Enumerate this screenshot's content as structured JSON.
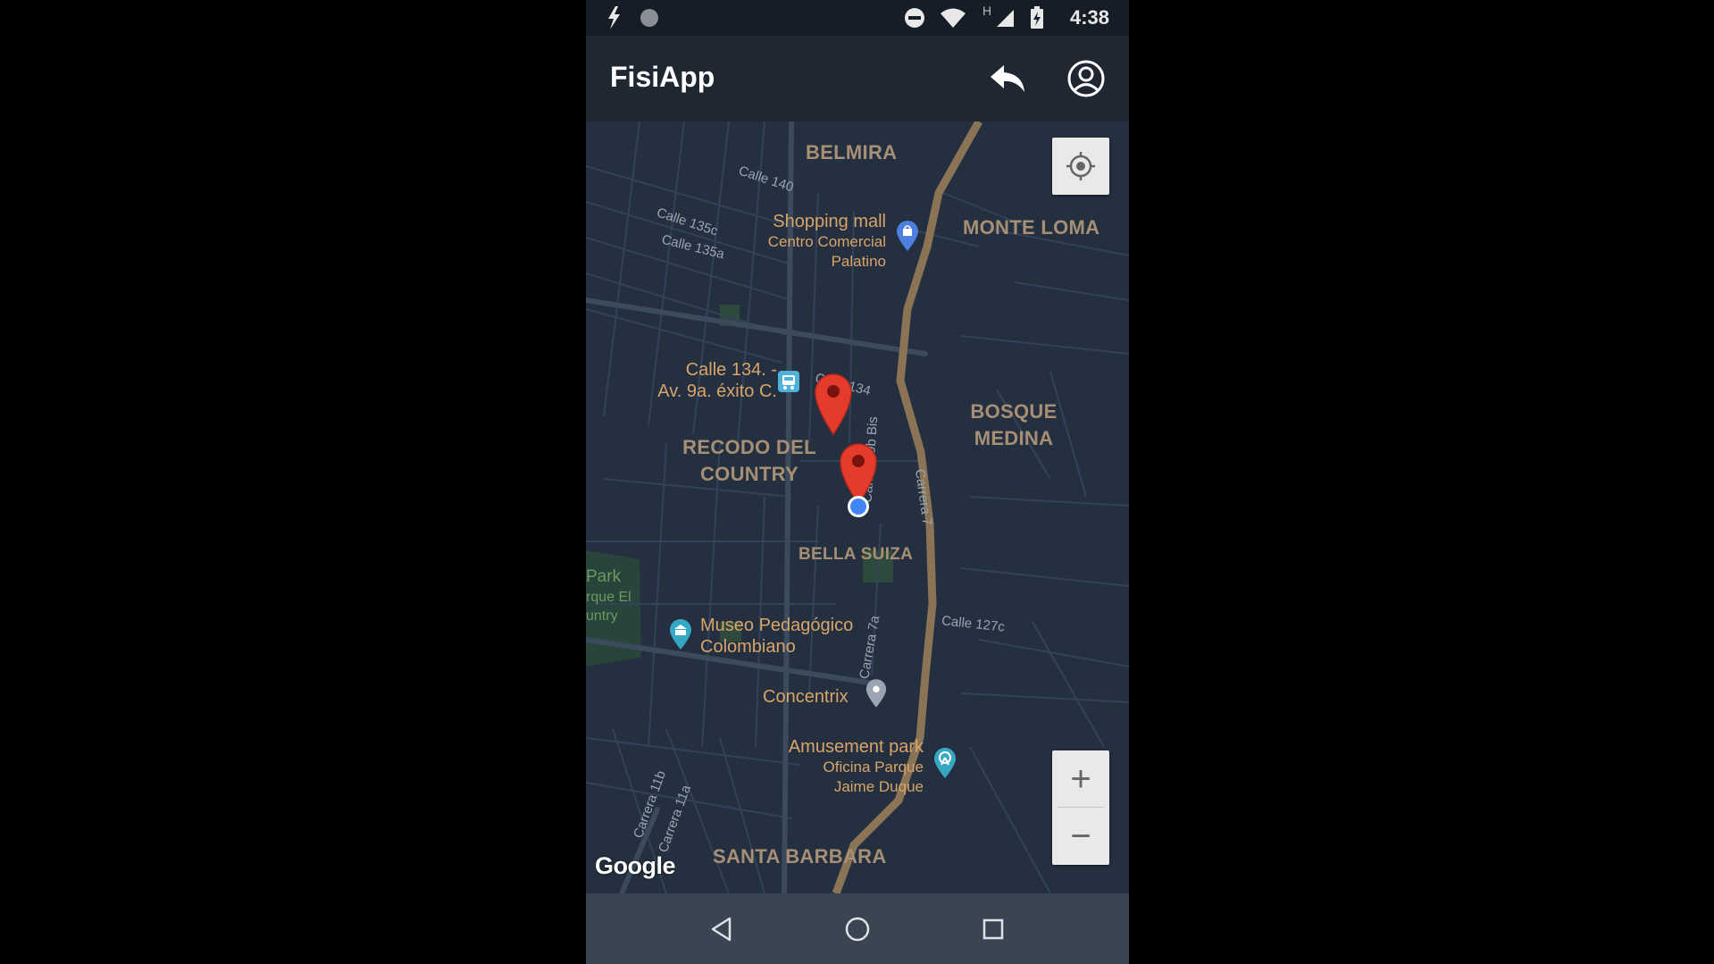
{
  "status_bar": {
    "time": "4:38",
    "network_type": "H",
    "icons": [
      "bolt-icon",
      "dot-icon",
      "do-not-disturb-icon",
      "wifi-icon",
      "signal-icon",
      "battery-charging-icon"
    ]
  },
  "app_bar": {
    "title": "FisiApp",
    "actions": [
      "reply-icon",
      "account-circle-icon"
    ]
  },
  "map": {
    "areas": {
      "belmira": "BELMIRA",
      "monte_loma": "MONTE LOMA",
      "bosque_medina": [
        "BOSQUE",
        "MEDINA"
      ],
      "recodo_del_country": [
        "RECODO DEL",
        "COUNTRY"
      ],
      "bella_suiza": "BELLA SUIZA",
      "santa_barbara": "SANTA BARBARA"
    },
    "streets": {
      "calle_140": "Calle 140",
      "calle_135c": "Calle 135c",
      "calle_135a": "Calle 135a",
      "calle_134": "Calle 134",
      "carrera_9b_bis": "Carrera 9b Bis",
      "carrera_7": "Carrera 7",
      "calle_127c": "Calle 127c",
      "carrera_7a": "Carrera 7a",
      "carrera_11b": "Carrera 11b",
      "carrera_11a": "Carrera 11a"
    },
    "pois": {
      "shopping_mall": {
        "title": "Shopping mall",
        "subtitle": [
          "Centro Comercial",
          "Palatino"
        ],
        "icon": "shopping-bag-icon"
      },
      "transit": {
        "lines": [
          "Calle 134. -",
          "Av. 9a. éxito C."
        ],
        "icon": "bus-stop-icon"
      },
      "museum": {
        "lines": [
          "Museo Pedagógico",
          "Colombiano"
        ],
        "icon": "museum-icon"
      },
      "concentrix": {
        "title": "Concentrix",
        "icon": "place-pin-icon"
      },
      "amusement_park": {
        "title": "Amusement park",
        "subtitle": [
          "Oficina Parque",
          "Jaime Duque"
        ],
        "icon": "amusement-park-icon"
      },
      "park": {
        "lines": [
          "Park",
          "rque El",
          "untry"
        ]
      }
    },
    "markers": [
      "red-marker-icon",
      "red-marker-icon"
    ],
    "my_location": "blue-dot",
    "attribution": "Google",
    "controls": {
      "my_location_button": "crosshair-icon",
      "zoom_in": "+",
      "zoom_out": "−"
    }
  },
  "nav_bar": {
    "buttons": [
      "back-triangle-icon",
      "home-circle-icon",
      "recents-square-icon"
    ]
  },
  "colors": {
    "map_background": "#243040",
    "road": "#3b4a5c",
    "highway": "#8a7455",
    "marker": "#e53b2d",
    "location_dot": "#4285f4",
    "area_label": "#a68f74",
    "poi_label": "#d9a469"
  }
}
